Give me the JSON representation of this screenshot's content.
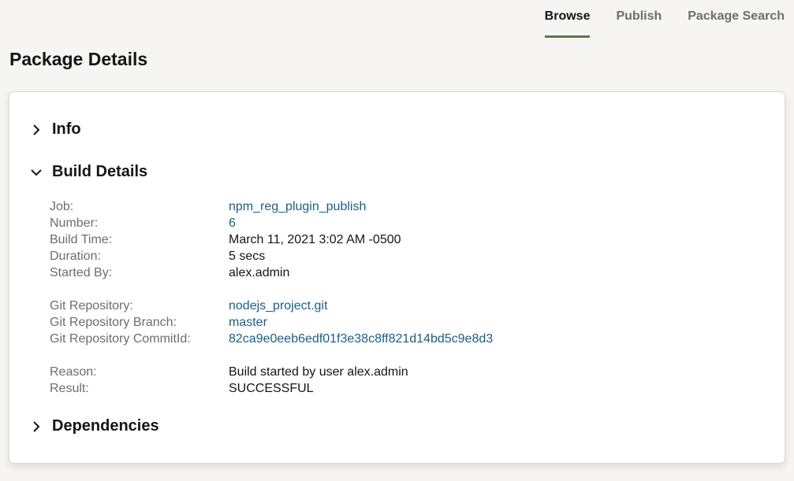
{
  "tabs": [
    {
      "label": "Browse",
      "active": true
    },
    {
      "label": "Publish",
      "active": false
    },
    {
      "label": "Package Search",
      "active": false
    }
  ],
  "page_title": "Package Details",
  "sections": {
    "info": {
      "title": "Info",
      "expanded": false
    },
    "build_details": {
      "title": "Build Details",
      "expanded": true
    },
    "dependencies": {
      "title": "Dependencies",
      "expanded": false
    }
  },
  "build": {
    "job": {
      "label": "Job:",
      "value": "npm_reg_plugin_publish"
    },
    "number": {
      "label": "Number:",
      "value": "6"
    },
    "build_time": {
      "label": "Build Time:",
      "value": "March 11, 2021 3:02 AM -0500"
    },
    "duration": {
      "label": "Duration:",
      "value": "5 secs"
    },
    "started_by": {
      "label": "Started By:",
      "value": "alex.admin"
    },
    "git_repository": {
      "label": "Git Repository:",
      "value": "nodejs_project.git"
    },
    "git_branch": {
      "label": "Git Repository Branch:",
      "value": "master"
    },
    "git_commit": {
      "label": "Git Repository CommitId:",
      "value": "82ca9e0eeb6edf01f3e38c8ff821d14bd5c9e8d3"
    },
    "reason": {
      "label": "Reason:",
      "value": "Build started by user alex.admin"
    },
    "result": {
      "label": "Result:",
      "value": "SUCCESSFUL"
    }
  },
  "colors": {
    "accent": "#5b7a4a",
    "link": "#1b5e84",
    "background": "#f7f5f3"
  }
}
